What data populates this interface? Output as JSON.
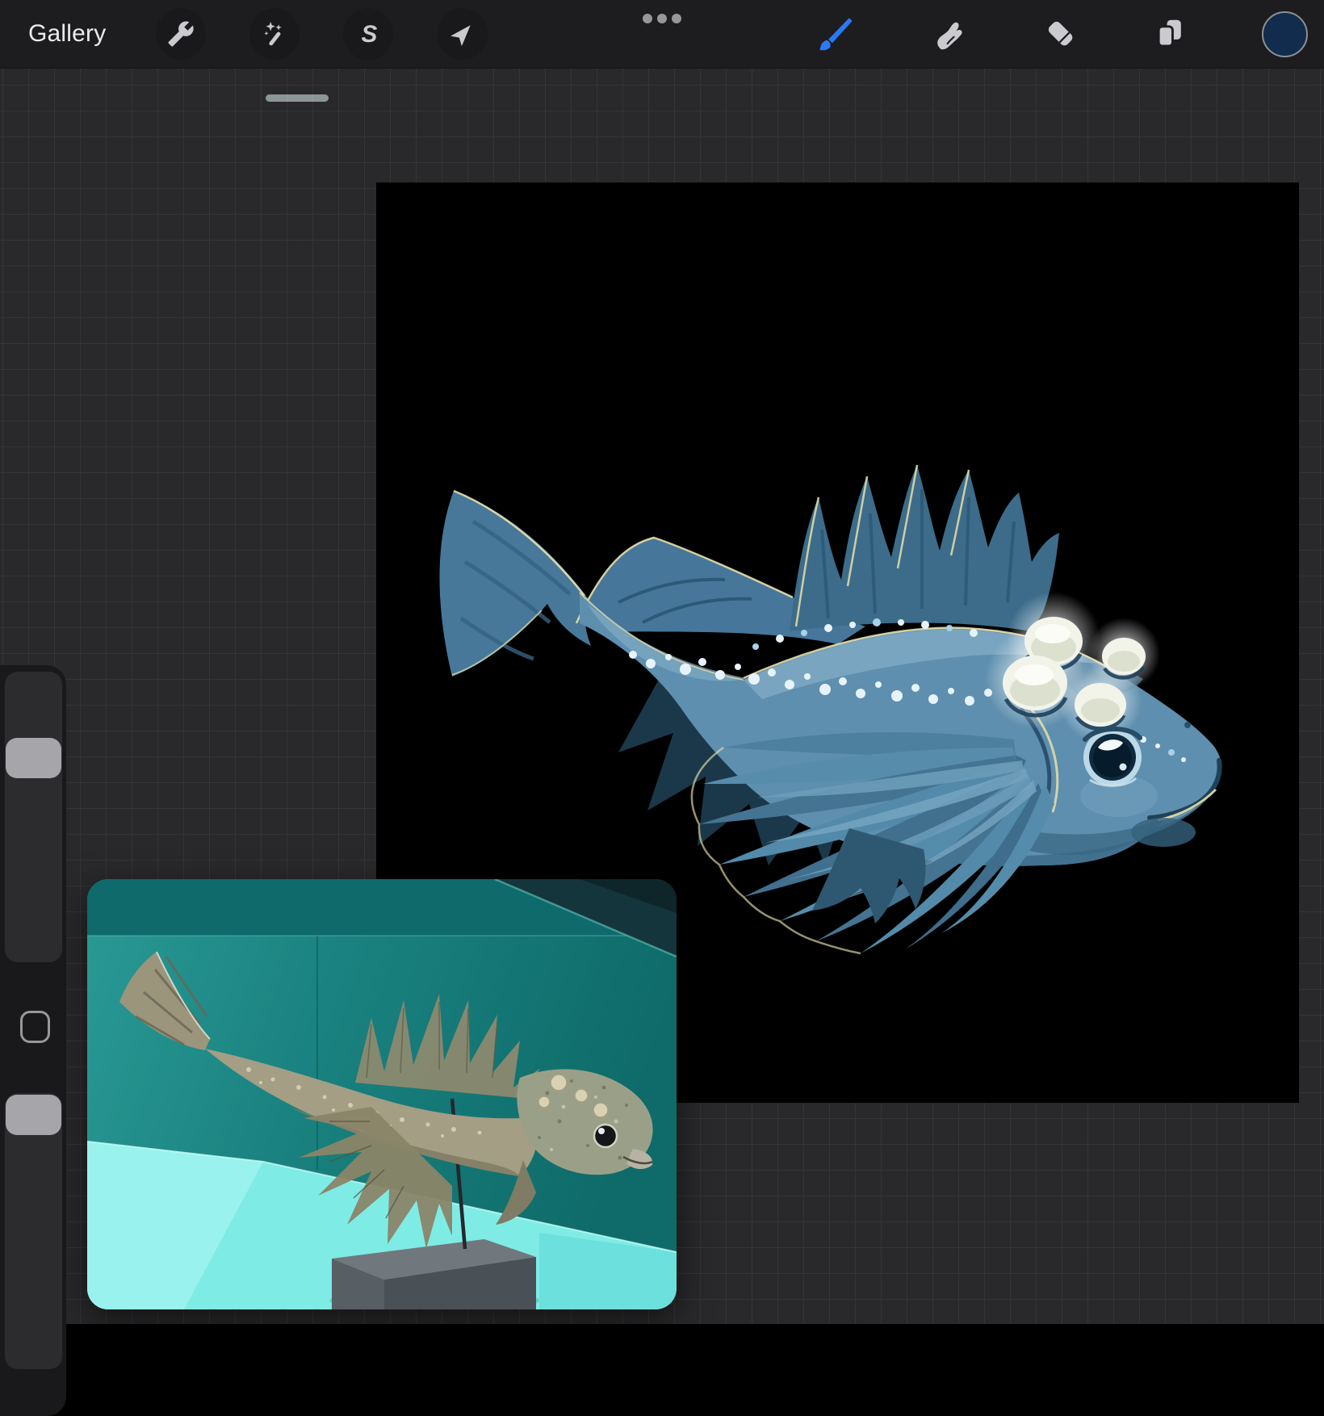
{
  "theme": {
    "topbar_bg": "#1d1d1f",
    "workspace_bg": "#29292b",
    "grid_line": "#353538",
    "panel_dark": "#19191b",
    "track_dark": "#2c2c2e",
    "handle_gray": "#a6a6aa",
    "icon_gray": "#cacacf",
    "accent_blue": "#2979f7",
    "swatch_navy": "#112c4d",
    "swatch_ring": "#8e8e93",
    "canvas_black": "#000000",
    "teal_wall": "#1a8280",
    "teal_wall_dark": "#0f6a6c",
    "platform_cyan": "#7febe5",
    "base_gray": "#575f65",
    "fish_blue": "#5e8fae",
    "fish_blue_dark": "#3c6c8a",
    "fish_belly": "#3f6e8c",
    "fish_cream": "#e8dfa8",
    "photo_fish_tan": "#a39e84"
  },
  "top_bar": {
    "gallery_label": "Gallery",
    "left_tools": [
      {
        "name": "actions",
        "icon": "wrench-icon"
      },
      {
        "name": "adjustments",
        "icon": "magic-wand-icon"
      },
      {
        "name": "selection",
        "icon": "selection-ribbon-icon",
        "glyph": "S"
      },
      {
        "name": "transform",
        "icon": "arrow-cursor-icon"
      }
    ],
    "overflow": {
      "name": "more",
      "icon": "ellipsis-icon"
    },
    "right_tools": [
      {
        "name": "paint",
        "icon": "paintbrush-icon",
        "active": true,
        "color": "#2979f7"
      },
      {
        "name": "smudge",
        "icon": "smudge-finger-icon"
      },
      {
        "name": "erase",
        "icon": "eraser-icon"
      },
      {
        "name": "layers",
        "icon": "layers-icon"
      },
      {
        "name": "color",
        "icon": "color-swatch",
        "value": "#112c4d"
      }
    ]
  },
  "sidebar": {
    "top_slider": "brush-size-slider",
    "bottom_slider": "brush-opacity-slider",
    "modify_button": "modify-button"
  },
  "canvas": {
    "background": "#000000",
    "artwork": "digital painting of a blue sculpin-like fish with four glowing white head bumps, spiky dorsal and pectoral fins, forked tail, rows of pale spots, cream outline accents"
  },
  "reference_window": {
    "content": "photo of a mounted fish specimen (taxidermy sculpin) on a thin rod above a dark grey base block, bright cyan pedestal, dark teal aquarium wall",
    "handle": "drag-handle"
  }
}
